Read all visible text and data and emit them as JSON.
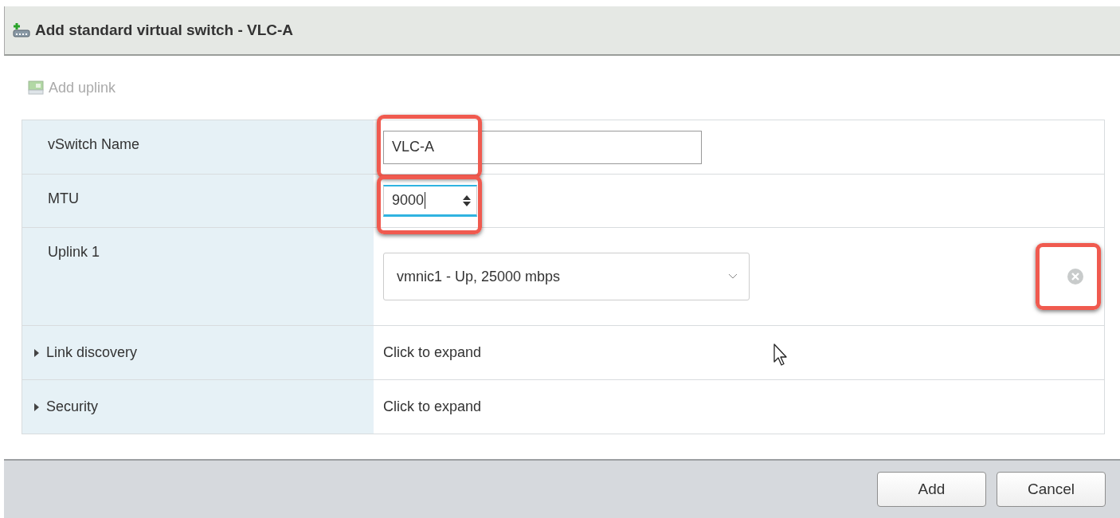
{
  "window": {
    "title": "Add standard virtual switch - VLC-A"
  },
  "toolbar": {
    "add_uplink": {
      "label": "Add uplink",
      "disabled": true
    }
  },
  "rows": [
    {
      "kind": "text",
      "label": "vSwitch Name",
      "value": "VLC-A",
      "highlighted": true
    },
    {
      "kind": "number",
      "label": "MTU",
      "value": "9000",
      "focused": true,
      "highlighted": true
    },
    {
      "kind": "select",
      "label": "Uplink 1",
      "value": "vmnic1 - Up, 25000 mbps",
      "remove_highlighted": true
    },
    {
      "kind": "expander",
      "label": "Link discovery",
      "value": "Click to expand",
      "expanded": false
    },
    {
      "kind": "expander",
      "label": "Security",
      "value": "Click to expand",
      "expanded": false
    }
  ],
  "buttons": [
    "Add",
    "Cancel"
  ]
}
